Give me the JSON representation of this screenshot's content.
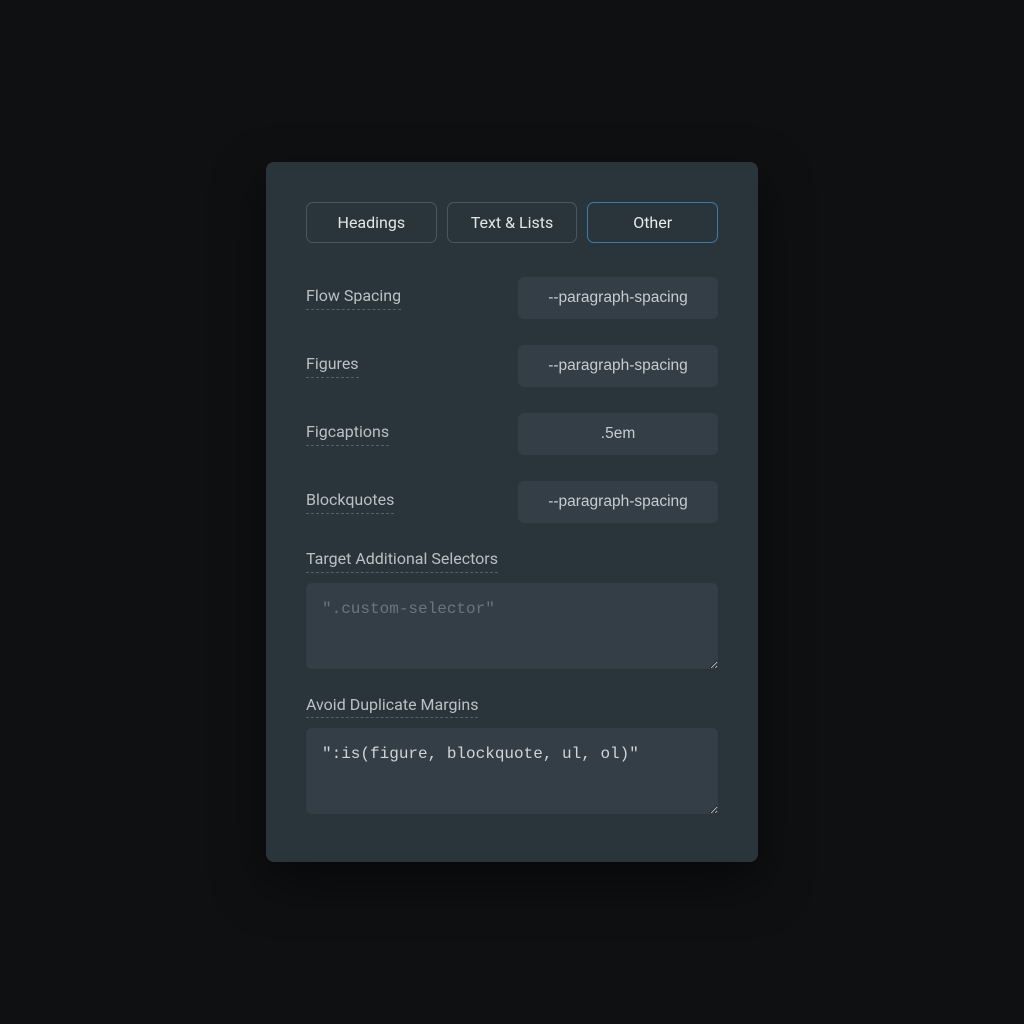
{
  "tabs": {
    "headings": "Headings",
    "text_lists": "Text & Lists",
    "other": "Other",
    "active": "other"
  },
  "fields": {
    "flow_spacing": {
      "label": "Flow Spacing",
      "value": "--paragraph-spacing"
    },
    "figures": {
      "label": "Figures",
      "value": "--paragraph-spacing"
    },
    "figcaptions": {
      "label": "Figcaptions",
      "value": ".5em"
    },
    "blockquotes": {
      "label": "Blockquotes",
      "value": "--paragraph-spacing"
    }
  },
  "target_selectors": {
    "label": "Target Additional Selectors",
    "placeholder": "\".custom-selector\"",
    "value": ""
  },
  "avoid_duplicate": {
    "label": "Avoid Duplicate Margins",
    "value": "\":is(figure, blockquote, ul, ol)\""
  }
}
